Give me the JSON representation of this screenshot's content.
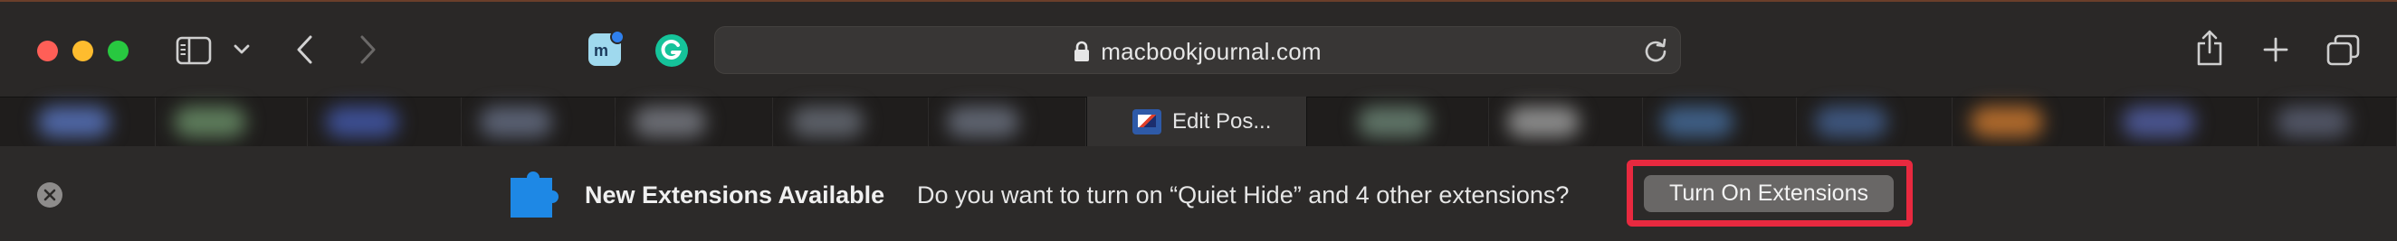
{
  "toolbar": {
    "address": "macbookjournal.com"
  },
  "tabs": {
    "active_label": "Edit Pos..."
  },
  "colors": {
    "accent_highlight": "#e8293f",
    "puzzle_blue": "#1e88e5",
    "grammarly_green": "#15c39a"
  },
  "icons": {
    "sidebar": "sidebar-icon",
    "back": "chevron-left-icon",
    "forward": "chevron-right-icon",
    "reload": "reload-icon",
    "share": "share-icon",
    "new_tab": "plus-icon",
    "tab_overview": "tab-overview-icon"
  },
  "banner": {
    "title": "New Extensions Available",
    "message": "Do you want to turn on “Quiet Hide” and 4 other extensions?",
    "button_label": "Turn On Extensions"
  }
}
